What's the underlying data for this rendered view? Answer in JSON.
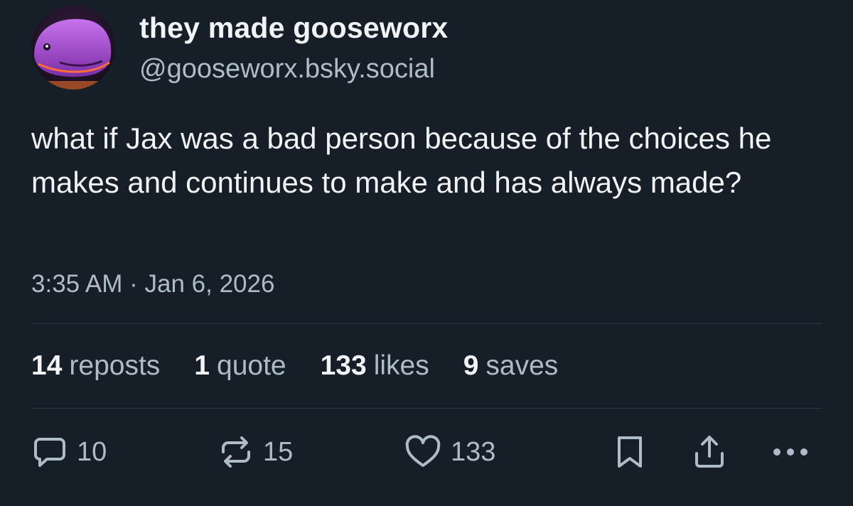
{
  "author": {
    "display_name": "they made gooseworx",
    "handle": "@gooseworx.bsky.social",
    "avatar_icon": "purple-creature-avatar"
  },
  "post": {
    "text": "what if Jax was a bad person because of the choices he makes and continues to make and has always made?",
    "timestamp": "3:35 AM · Jan 6, 2026"
  },
  "stats": [
    {
      "count": "14",
      "label": "reposts"
    },
    {
      "count": "1",
      "label": "quote"
    },
    {
      "count": "133",
      "label": "likes"
    },
    {
      "count": "9",
      "label": "saves"
    }
  ],
  "actions": {
    "reply": {
      "icon": "reply-bubble-icon",
      "count": "10"
    },
    "repost": {
      "icon": "repost-icon",
      "count": "15"
    },
    "like": {
      "icon": "heart-icon",
      "count": "133"
    },
    "save": {
      "icon": "bookmark-icon"
    },
    "share": {
      "icon": "share-icon"
    },
    "more": {
      "icon": "more-dots-icon"
    }
  },
  "colors": {
    "background": "#161e27",
    "text_primary": "#f1f3f5",
    "text_secondary": "#aebbc9",
    "divider": "#2c3846"
  }
}
